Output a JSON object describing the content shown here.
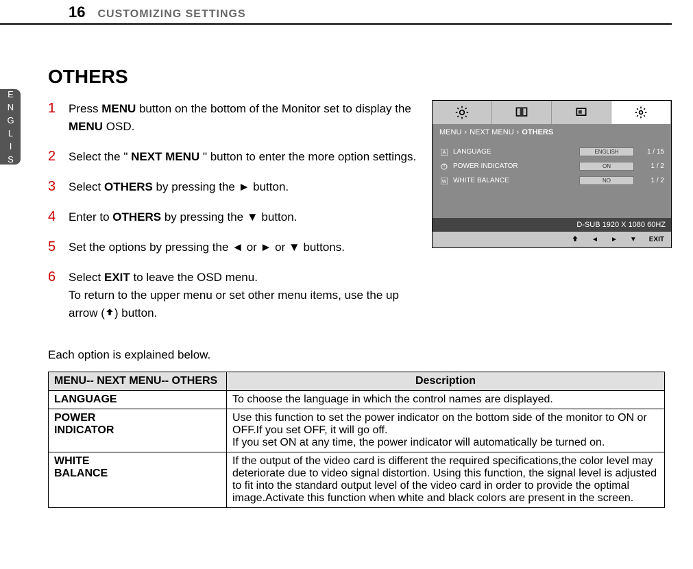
{
  "header": {
    "page_number": "16",
    "title": "CUSTOMIZING SETTINGS"
  },
  "side_tab": "ENGLISH",
  "section_title": "OTHERS",
  "steps": {
    "s1": {
      "num": "1",
      "prefix": "Press ",
      "b1": "MENU",
      "mid": " button on the bottom of the Monitor set to display  the ",
      "b2": "MENU",
      "suffix": " OSD."
    },
    "s2": {
      "num": "2",
      "prefix": "Select the \" ",
      "b1": "NEXT MENU",
      "suffix": " \" button to enter the more option settings."
    },
    "s3": {
      "num": "3",
      "prefix": "Select ",
      "b1": "OTHERS",
      "mid": " by pressing the ",
      "arrow": "►",
      "suffix": " button."
    },
    "s4": {
      "num": "4",
      "prefix": "Enter to ",
      "b1": "OTHERS",
      "mid": " by pressing the ",
      "arrow": "▼",
      "suffix": " button."
    },
    "s5": {
      "num": "5",
      "text": "Set the options by pressing the ◄ or ► or ▼ buttons."
    },
    "s6": {
      "num": "6",
      "prefix": "Select ",
      "b1": "EXIT",
      "mid": " to leave the OSD menu.",
      "line2_pre": "To return to the upper menu or set other menu items, use the up arrow (",
      "line2_post": ") button."
    }
  },
  "osd": {
    "breadcrumb": {
      "a": "MENU",
      "b": "NEXT MENU",
      "c": "OTHERS"
    },
    "rows": {
      "language": {
        "label": "LANGUAGE",
        "value": "ENGLISH",
        "counter": "1 / 15"
      },
      "power": {
        "label": "POWER INDICATOR",
        "value": "ON",
        "counter": "1 / 2"
      },
      "wb": {
        "label": "WHITE BALANCE",
        "value": "NO",
        "counter": "1 / 2"
      }
    },
    "status": "D-SUB 1920 X 1080 60HZ",
    "footer": {
      "exit": "EXIT"
    }
  },
  "subtext": "Each option is explained below.",
  "table": {
    "head_left": "MENU-- NEXT MENU-- OTHERS",
    "head_right": "Description",
    "rows": {
      "r1": {
        "label": "LANGUAGE",
        "desc": "To choose the language in which the control names are displayed."
      },
      "r2": {
        "label": "POWER\nINDICATOR",
        "desc": "Use this function to set the power indicator on the bottom side of the monitor to ON or OFF.If you set OFF, it will go off.\nIf you set ON at any time, the power indicator will automatically be turned on."
      },
      "r3": {
        "label": "WHITE\nBALANCE",
        "desc": "If the output of the video card is different the required specifications,the color level may deteriorate due to video signal distortion. Using this function, the signal level is adjusted to fit into the standard output level of the video card in order to provide the optimal image.Activate this function when white and black colors are present in the screen."
      }
    }
  }
}
